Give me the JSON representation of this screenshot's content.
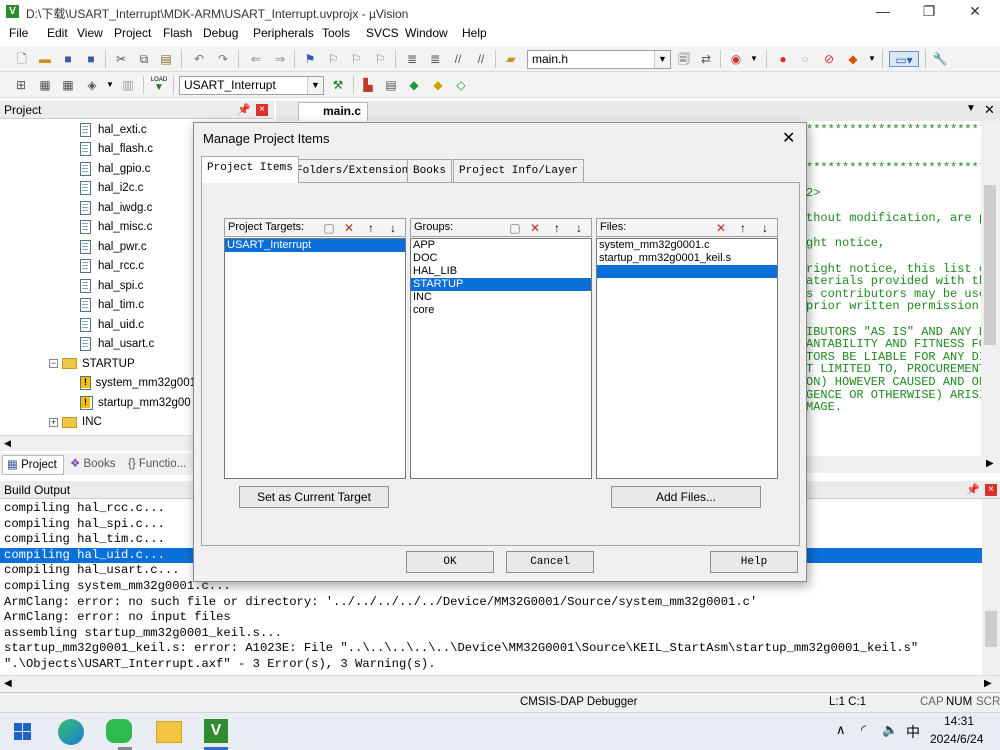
{
  "window": {
    "title": "D:\\下载\\USART_Interrupt\\MDK-ARM\\USART_Interrupt.uvprojx - µVision",
    "minimize": "—",
    "restore": "❐",
    "close": "✕"
  },
  "menu": [
    "File",
    "Edit",
    "View",
    "Project",
    "Flash",
    "Debug",
    "Peripherals",
    "Tools",
    "SVCS",
    "Window",
    "Help"
  ],
  "toolbar": {
    "file_combo": "main.h",
    "target_combo": "USART_Interrupt",
    "load_label": "LOAD"
  },
  "project_panel": {
    "title": "Project",
    "tree": [
      {
        "label": "hal_exti.c",
        "type": "file"
      },
      {
        "label": "hal_flash.c",
        "type": "file"
      },
      {
        "label": "hal_gpio.c",
        "type": "file"
      },
      {
        "label": "hal_i2c.c",
        "type": "file"
      },
      {
        "label": "hal_iwdg.c",
        "type": "file"
      },
      {
        "label": "hal_misc.c",
        "type": "file"
      },
      {
        "label": "hal_pwr.c",
        "type": "file"
      },
      {
        "label": "hal_rcc.c",
        "type": "file"
      },
      {
        "label": "hal_spi.c",
        "type": "file"
      },
      {
        "label": "hal_tim.c",
        "type": "file"
      },
      {
        "label": "hal_uid.c",
        "type": "file"
      },
      {
        "label": "hal_usart.c",
        "type": "file"
      },
      {
        "label": "STARTUP",
        "type": "folder-open"
      },
      {
        "label": "system_mm32g001",
        "type": "warn"
      },
      {
        "label": "startup_mm32g00",
        "type": "warn"
      },
      {
        "label": "INC",
        "type": "folder-closed"
      }
    ],
    "tabs": [
      "Project",
      "Books",
      "Functio..."
    ]
  },
  "editor": {
    "tab": "main.c",
    "lines": [
      "******************************",
      "",
      "",
      "******************************",
      "",
      "2>",
      "",
      "thout modification, are p",
      "",
      "ght notice,",
      "",
      "right notice, this list c",
      "aterials provided with th",
      "s contributors may be use",
      "prior written permission",
      "",
      "IBUTORS \"AS IS\" AND ANY EX",
      "ANTABILITY AND FITNESS FOR",
      "TORS BE LIABLE FOR ANY DIR",
      "T LIMITED TO, PROCUREMENT",
      "ON) HOWEVER CAUSED AND ON",
      "GENCE OR OTHERWISE) ARISI",
      "MAGE."
    ]
  },
  "build_output": {
    "title": "Build Output",
    "lines": [
      "compiling hal_rcc.c...",
      "compiling hal_spi.c...",
      "compiling hal_tim.c...",
      "compiling hal_uid.c...",
      "compiling hal_usart.c...",
      "compiling system_mm32g0001.c...",
      "ArmClang: error: no such file or directory: '../../../../../Device/MM32G0001/Source/system_mm32g0001.c'",
      "ArmClang: error: no input files",
      "assembling startup_mm32g0001_keil.s...",
      "startup_mm32g0001_keil.s: error: A1023E: File \"..\\..\\..\\..\\..\\Device\\MM32G0001\\Source\\KEIL_StartAsm\\startup_mm32g0001_keil.s\"",
      "\".\\Objects\\USART_Interrupt.axf\" - 3 Error(s), 3 Warning(s)."
    ],
    "selected_index": 3
  },
  "status": {
    "debugger": "CMSIS-DAP Debugger",
    "position": "L:1 C:1",
    "caps": "CAP",
    "num": "NUM",
    "scrl": "SCRL"
  },
  "taskbar": {
    "time": "14:31",
    "date": "2024/6/24",
    "ime": "中"
  },
  "dialog": {
    "title": "Manage Project Items",
    "tabs": [
      "Project Items",
      "Folders/Extensions",
      "Books",
      "Project Info/Layer"
    ],
    "targets": {
      "header": "Project Targets:",
      "items": [
        "USART_Interrupt"
      ],
      "selected": 0
    },
    "groups": {
      "header": "Groups:",
      "items": [
        "APP",
        "DOC",
        "HAL_LIB",
        "STARTUP",
        "INC",
        "core"
      ],
      "selected": 3
    },
    "files": {
      "header": "Files:",
      "items": [
        "system_mm32g0001.c",
        "startup_mm32g0001_keil.s",
        ""
      ],
      "selected": 2
    },
    "set_current": "Set as Current Target",
    "add_files": "Add Files...",
    "ok": "OK",
    "cancel": "Cancel",
    "help": "Help"
  },
  "colors": {
    "selection": "#0a6fd8",
    "code_comment": "#1f8a1f",
    "error_red": "#d9312b"
  }
}
